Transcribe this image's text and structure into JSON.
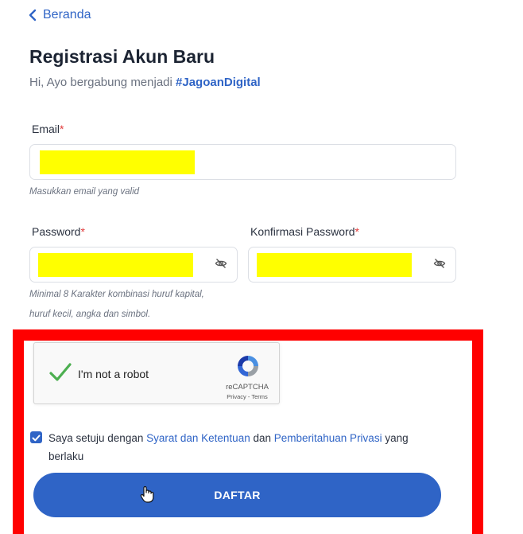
{
  "nav": {
    "back_label": "Beranda"
  },
  "header": {
    "title": "Registrasi Akun Baru",
    "subtitle_prefix": "Hi, Ayo bergabung menjadi ",
    "subtitle_tag": "#JagoanDigital"
  },
  "form": {
    "email": {
      "label": "Email",
      "required_mark": "*",
      "value": "redacted",
      "hint": "Masukkan email yang valid"
    },
    "password": {
      "label": "Password",
      "required_mark": "*",
      "value": "redacted",
      "hint_line1": "Minimal 8 Karakter kombinasi huruf kapital,",
      "hint_line2": "huruf kecil, angka dan simbol."
    },
    "confirm_password": {
      "label": "Konfirmasi Password",
      "required_mark": "*",
      "value": "redacted"
    }
  },
  "recaptcha": {
    "label": "I'm not a robot",
    "brand": "reCAPTCHA",
    "links": "Privacy - Terms",
    "checked": true
  },
  "agreement": {
    "prefix": "Saya setuju dengan ",
    "terms_link": "Syarat dan Ketentuan",
    "middle": " dan ",
    "privacy_link": "Pemberitahuan Privasi",
    "suffix": " yang berlaku",
    "checked": true
  },
  "submit": {
    "label": "DAFTAR"
  },
  "colors": {
    "accent": "#2f64c6",
    "required": "#e23b3b",
    "highlight_border": "#ff0000",
    "redaction": "#ffff00",
    "recaptcha_check": "#4caf50"
  },
  "icons": {
    "back": "chevron-left-icon",
    "eye": "eye-off-icon",
    "recaptcha": "recaptcha-logo-icon",
    "checkbox": "checkmark-icon",
    "cursor": "hand-pointer-icon"
  }
}
